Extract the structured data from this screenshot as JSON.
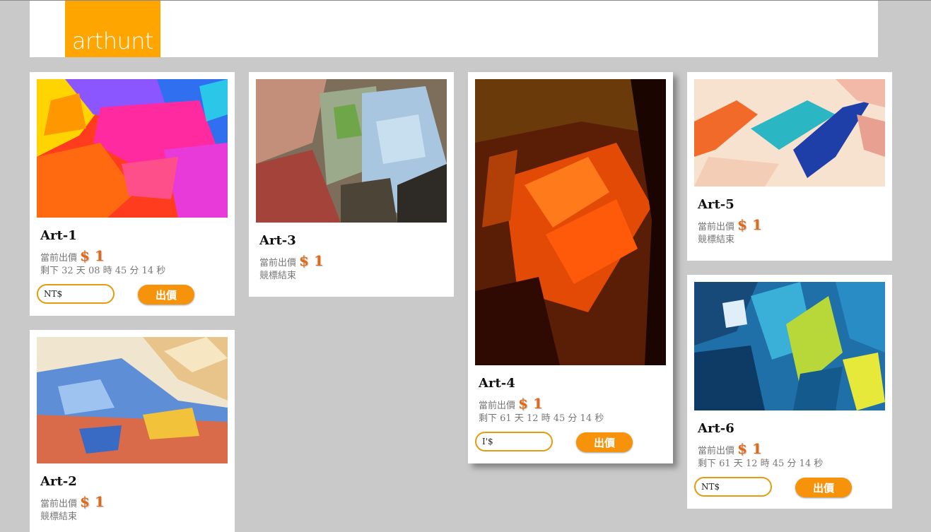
{
  "brand": {
    "logo_text": "arthunt",
    "accent": "#ffa500"
  },
  "labels": {
    "current_bid": "當前出價",
    "bid_button": "出價"
  },
  "artworks": [
    {
      "title": "Art-1",
      "price": "$ 1",
      "status": "剩下 32 天 08 時 45 分 14 秒",
      "input_value": "NT$"
    },
    {
      "title": "Art-2",
      "price": "$ 1",
      "status": "競標結束"
    },
    {
      "title": "Art-3",
      "price": "$ 1",
      "status": "競標結束"
    },
    {
      "title": "Art-4",
      "price": "$ 1",
      "status": "剩下 61 天 12 時 45 分 14 秒",
      "input_value": "I'$"
    },
    {
      "title": "Art-5",
      "price": "$ 1",
      "status": "競標結束"
    },
    {
      "title": "Art-6",
      "price": "$ 1",
      "status": "剩下 61 天 12 時 45 分 14 秒",
      "input_value": "NT$"
    }
  ]
}
